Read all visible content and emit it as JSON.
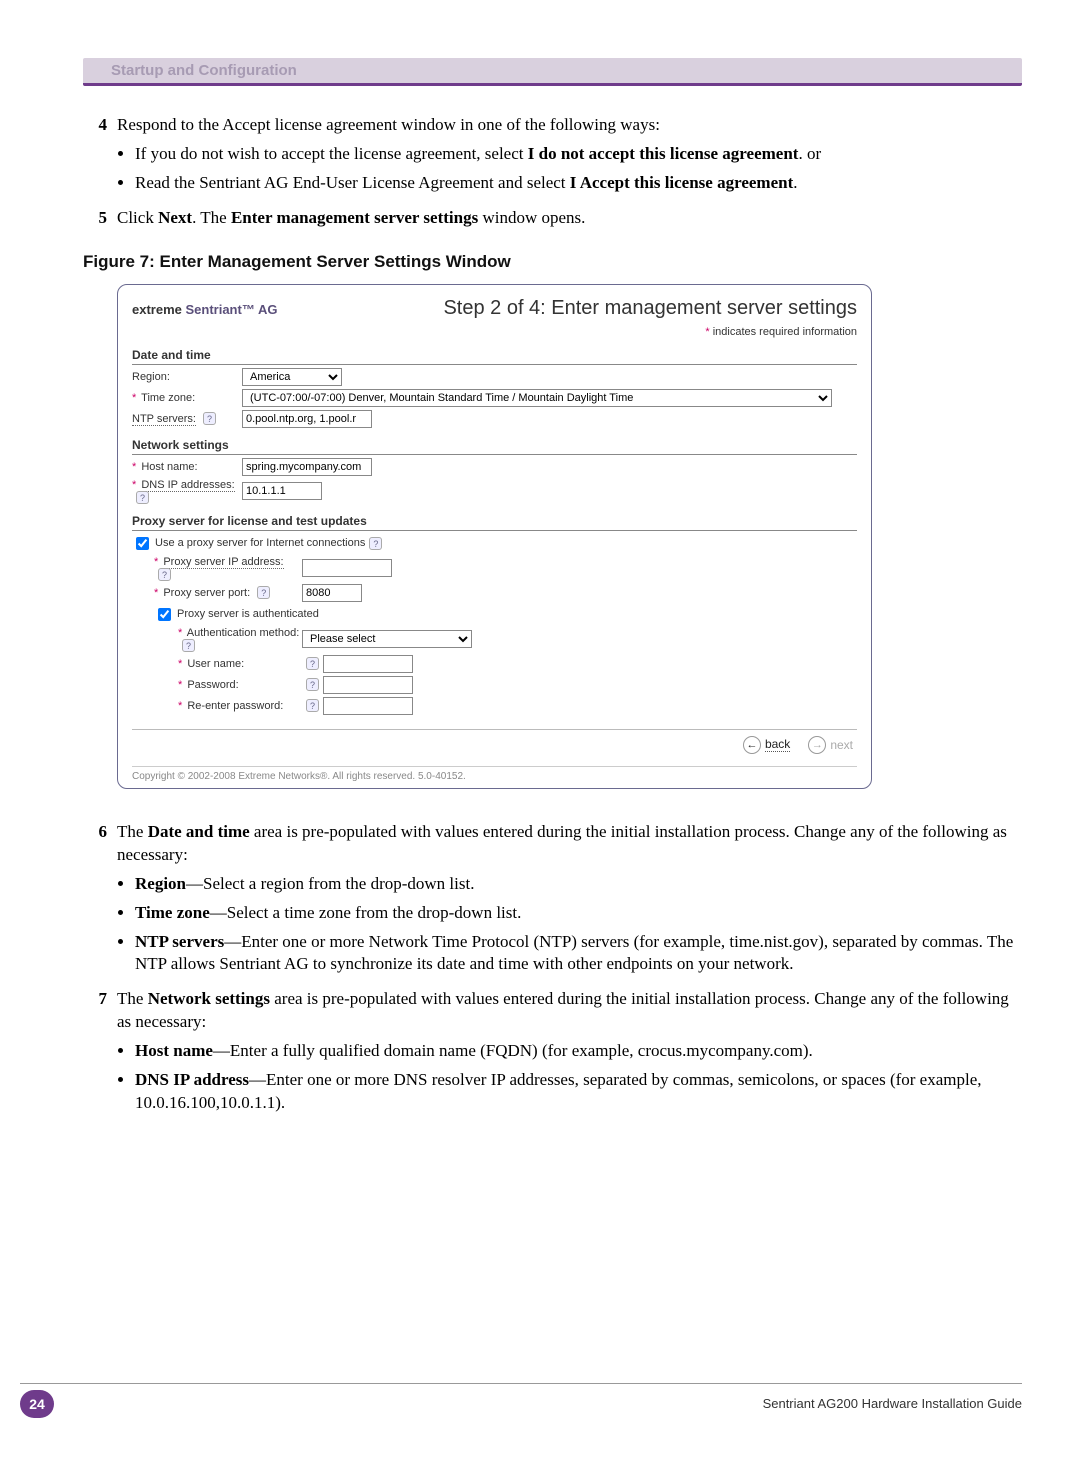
{
  "header": {
    "breadcrumb": "Startup and Configuration"
  },
  "steps": {
    "s4": {
      "num": "4",
      "text": "Respond to the Accept license agreement window in one of the following ways:",
      "b1a": "If you do not wish to accept the license agreement, select ",
      "b1b": "I do not accept this license agreement",
      "b1c": ". or",
      "b2a": "Read the Sentriant AG End-User License Agreement and select ",
      "b2b": "I Accept this license agreement",
      "b2c": "."
    },
    "s5": {
      "num": "5",
      "a": "Click ",
      "b": "Next",
      "c": ". The ",
      "d": "Enter management server settings",
      "e": " window opens."
    },
    "s6": {
      "num": "6",
      "a": "The ",
      "b": "Date and time",
      "c": " area is pre-populated with values entered during the initial installation process. Change any of the following as necessary:",
      "b1a": "Region",
      "b1b": "—Select a region from the drop-down list.",
      "b2a": "Time zone",
      "b2b": "—Select a time zone from the drop-down list.",
      "b3a": "NTP servers",
      "b3b": "—Enter one or more Network Time Protocol (NTP) servers (for example, time.nist.gov), separated by commas. The NTP allows Sentriant AG to synchronize its date and time with other endpoints on your network."
    },
    "s7": {
      "num": "7",
      "a": "The ",
      "b": "Network settings",
      "c": " area is pre-populated with values entered during the initial installation process. Change any of the following as necessary:",
      "b1a": "Host name",
      "b1b": "—Enter a fully qualified domain name (FQDN) (for example, crocus.mycompany.com).",
      "b2a": "DNS IP address",
      "b2b": "—Enter one or more DNS resolver IP addresses, separated by commas, semicolons, or spaces (for example, 10.0.16.100,10.0.1.1)."
    }
  },
  "figure": {
    "caption": "Figure 7: Enter Management Server Settings Window"
  },
  "win": {
    "brand_prefix": "extreme",
    "brand_name": " Sentriant™ AG",
    "title": "Step 2 of 4: Enter management server settings",
    "req_note": " indicates required information",
    "dt_head": "Date and time",
    "region_lbl": "Region:",
    "region_val": "America",
    "tz_lbl": "Time zone:",
    "tz_val": "(UTC-07:00/-07:00) Denver, Mountain Standard Time / Mountain Daylight Time",
    "ntp_lbl": "NTP servers:",
    "ntp_val": "0.pool.ntp.org, 1.pool.r",
    "net_head": "Network settings",
    "host_lbl": "Host name:",
    "host_val": "spring.mycompany.com",
    "dns_lbl": "DNS IP addresses:",
    "dns_val": "10.1.1.1",
    "proxy_head": "Proxy server for license and test updates",
    "use_proxy_lbl": "Use a proxy server for Internet connections",
    "pip_lbl": "Proxy server IP address:",
    "pport_lbl": "Proxy server port:",
    "pport_val": "8080",
    "pauth_lbl": "Proxy server is authenticated",
    "auth_lbl": "Authentication method:",
    "auth_val": "Please select",
    "user_lbl": "User name:",
    "pass_lbl": "Password:",
    "repass_lbl": "Re-enter password:",
    "back": "back",
    "next": "next",
    "copyright": "Copyright © 2002-2008 Extreme Networks®. All rights reserved. 5.0-40152."
  },
  "footer": {
    "page": "24",
    "guide": "Sentriant AG200 Hardware Installation Guide"
  }
}
